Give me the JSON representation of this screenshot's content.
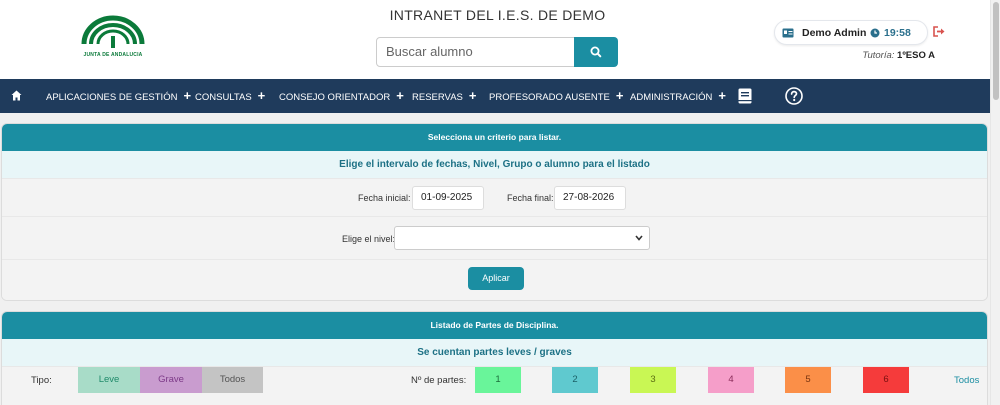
{
  "header": {
    "logo_text": "JUNTA DE ANDALUCIA",
    "title": "INTRANET DEL I.E.S. DE DEMO",
    "search": {
      "placeholder": "Buscar alumno"
    },
    "user": {
      "name": "Demo Admin",
      "time": "19:58"
    },
    "tutoria_label": "Tutoría:",
    "tutoria_value": "1ºESO A"
  },
  "nav": {
    "items": [
      {
        "label": "APLICACIONES DE GESTIÓN"
      },
      {
        "label": "CONSULTAS"
      },
      {
        "label": "CONSEJO ORIENTADOR"
      },
      {
        "label": "RESERVAS"
      },
      {
        "label": "PROFESORADO AUSENTE"
      },
      {
        "label": "ADMINISTRACIÓN"
      }
    ],
    "plus": "+"
  },
  "filter": {
    "head": "Selecciona un criterio para listar.",
    "sub": "Elige el intervalo de fechas, Nivel, Grupo o alumno para el listado",
    "fecha_inicial_label": "Fecha inicial:",
    "fecha_inicial": "01-09-2025",
    "fecha_final_label": "Fecha final:",
    "fecha_final": "27-08-2026",
    "nivel_label": "Elige el nivel:",
    "nivel_value": "",
    "apply": "Aplicar"
  },
  "listado": {
    "head": "Listado de Partes de Disciplina.",
    "sub": "Se cuentan partes leves / graves",
    "tipo_label": "Tipo:",
    "tipos": [
      "Leve",
      "Grave",
      "Todos"
    ],
    "nparts_label": "Nº de partes:",
    "counts": [
      "1",
      "2",
      "3",
      "4",
      "5",
      "6"
    ],
    "todos": "Todos"
  },
  "colors": {
    "primary": "#1b8ea2",
    "navbar": "#1f3b5c",
    "leve": "#a8dcc8",
    "grave": "#c99ccf",
    "todos": "#c4c4c4",
    "count_colors": [
      "#69f59a",
      "#5fc9cf",
      "#c9f754",
      "#f59ec9",
      "#fb8f48",
      "#f53b3b"
    ]
  }
}
